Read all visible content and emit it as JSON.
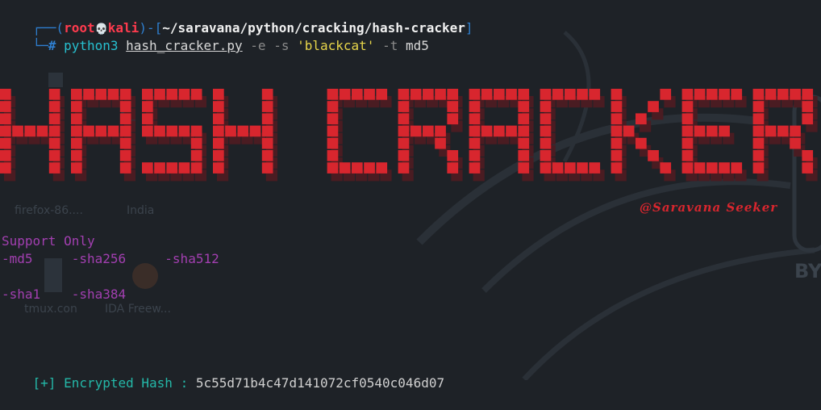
{
  "prompt": {
    "user": "root",
    "skull_glyph": "💀",
    "host": "kali",
    "cwd": "~/saravana/python/cracking/hash-cracker",
    "symbol": "#"
  },
  "command": {
    "program": "python3",
    "script": "hash_cracker.py",
    "flag_e": "-e",
    "flag_s": "-s",
    "secret": "'blackcat'",
    "flag_t": "-t",
    "algo": "md5"
  },
  "banner": {
    "text": "HASH CRACKER",
    "color": "#d8262e",
    "signature": "@Saravana Seeker"
  },
  "desktop_icons": {
    "firefox": "firefox-86....",
    "india": "India",
    "tmux": "tmux.con",
    "ida": "IDA Freew...",
    "side": "BY"
  },
  "support": {
    "heading": "Support Only",
    "row1": "-md5     -sha256     -sha512",
    "row2": "-sha1    -sha384"
  },
  "result": {
    "prefix": "[+]",
    "label": "Encrypted Hash : ",
    "value": "5c55d71b4c47d141072cf0540c046d07"
  }
}
